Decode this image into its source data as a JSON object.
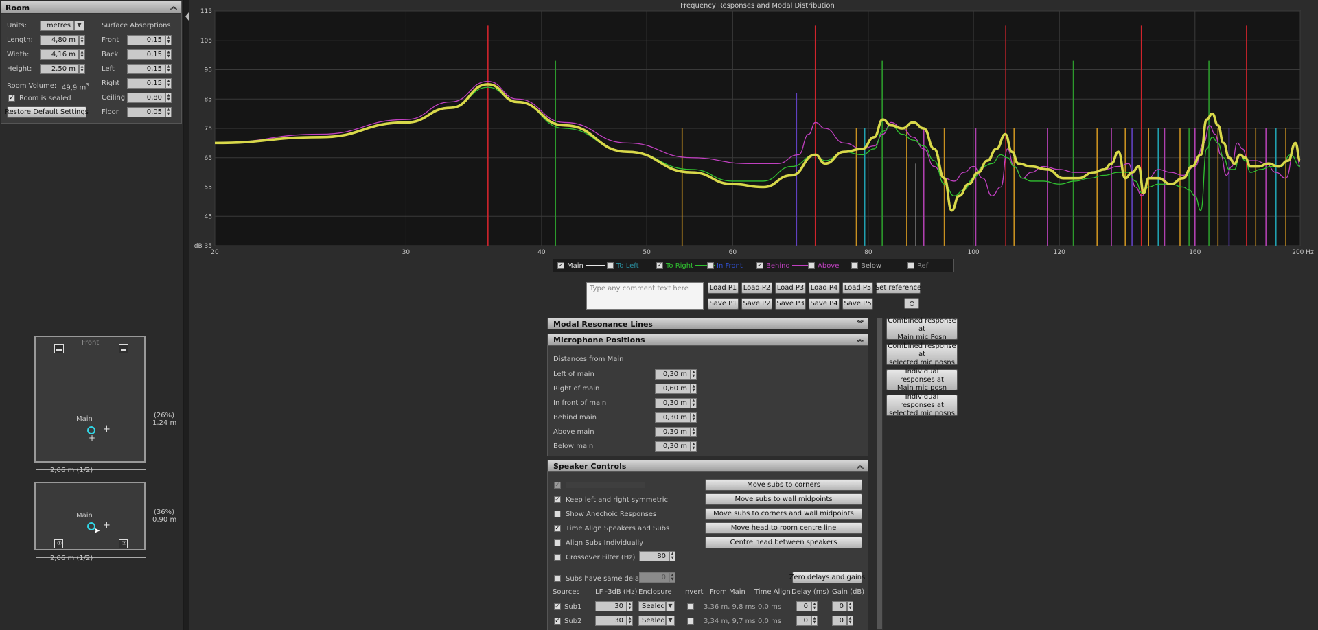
{
  "room": {
    "title": "Room",
    "units_label": "Units:",
    "units_value": "metres",
    "length_label": "Length:",
    "length_value": "4,80 m",
    "width_label": "Width:",
    "width_value": "4,16 m",
    "height_label": "Height:",
    "height_value": "2,50 m",
    "volume_label": "Room Volume:",
    "volume_value": "49,9 m",
    "volume_exp": "3",
    "sealed_label": "Room is sealed",
    "restore_label": "Restore Default Settings",
    "absorptions_title": "Surface Absorptions",
    "absorptions": [
      {
        "label": "Front",
        "value": "0,15"
      },
      {
        "label": "Back",
        "value": "0,15"
      },
      {
        "label": "Left",
        "value": "0,15"
      },
      {
        "label": "Right",
        "value": "0,15"
      },
      {
        "label": "Ceiling",
        "value": "0,80"
      },
      {
        "label": "Floor",
        "value": "0,05"
      }
    ]
  },
  "plan_top": {
    "front_label": "Front",
    "main_label": "Main",
    "pct": "(26%)",
    "dim_right": "1,24 m",
    "dim_bottom": "2,06 m (1/2)"
  },
  "plan_side": {
    "main_label": "Main",
    "pct": "(36%)",
    "dim_right": "0,90 m",
    "dim_bottom": "2,06 m (1/2)"
  },
  "chart_data": {
    "type": "line",
    "title": "Frequency Responses and Modal Distribution",
    "ylabel": "dB",
    "xlabel": "Hz",
    "xscale": "log",
    "xlim": [
      20,
      200
    ],
    "ylim": [
      35,
      115
    ],
    "xticks": [
      20,
      30,
      40,
      50,
      60,
      80,
      100,
      120,
      160,
      200
    ],
    "xtick_labels": [
      "20",
      "30",
      "40",
      "50",
      "60",
      "80",
      "100",
      "120",
      "160",
      "200 Hz"
    ],
    "yticks": [
      35,
      45,
      55,
      65,
      75,
      85,
      95,
      105,
      115
    ],
    "ytick_labels": [
      "dB 35",
      "45",
      "55",
      "65",
      "75",
      "85",
      "95",
      "105",
      "115"
    ],
    "grid": true,
    "background": "#151515",
    "modal_lines": [
      {
        "f": 35.7,
        "h": 110,
        "color": "#d0242c"
      },
      {
        "f": 41.2,
        "h": 98,
        "color": "#2c9a2c"
      },
      {
        "f": 53.9,
        "h": 75,
        "color": "#c89020"
      },
      {
        "f": 68.7,
        "h": 87,
        "color": "#6040c0"
      },
      {
        "f": 71.5,
        "h": 110,
        "color": "#d0242c"
      },
      {
        "f": 78.0,
        "h": 75,
        "color": "#c89020"
      },
      {
        "f": 79.4,
        "h": 75,
        "color": "#20a0b0"
      },
      {
        "f": 82.4,
        "h": 98,
        "color": "#2c9a2c"
      },
      {
        "f": 86.8,
        "h": 75,
        "color": "#c89020"
      },
      {
        "f": 88.5,
        "h": 63,
        "color": "#909090"
      },
      {
        "f": 90.0,
        "h": 75,
        "color": "#b040b0"
      },
      {
        "f": 94.0,
        "h": 75,
        "color": "#c89020"
      },
      {
        "f": 100.5,
        "h": 75,
        "color": "#b040b0"
      },
      {
        "f": 107.1,
        "h": 110,
        "color": "#d0242c"
      },
      {
        "f": 109.0,
        "h": 75,
        "color": "#c89020"
      },
      {
        "f": 117.0,
        "h": 75,
        "color": "#b040b0"
      },
      {
        "f": 123.6,
        "h": 98,
        "color": "#2c9a2c"
      },
      {
        "f": 130.0,
        "h": 75,
        "color": "#c89020"
      },
      {
        "f": 134.0,
        "h": 75,
        "color": "#b040b0"
      },
      {
        "f": 138.0,
        "h": 75,
        "color": "#c89020"
      },
      {
        "f": 140.0,
        "h": 75,
        "color": "#6040c0"
      },
      {
        "f": 142.8,
        "h": 110,
        "color": "#d0242c"
      },
      {
        "f": 145.0,
        "h": 75,
        "color": "#c89020"
      },
      {
        "f": 148.0,
        "h": 75,
        "color": "#20a0b0"
      },
      {
        "f": 150.0,
        "h": 75,
        "color": "#b040b0"
      },
      {
        "f": 155.0,
        "h": 75,
        "color": "#c89020"
      },
      {
        "f": 158.0,
        "h": 75,
        "color": "#2c9a2c"
      },
      {
        "f": 160.0,
        "h": 75,
        "color": "#b040b0"
      },
      {
        "f": 164.8,
        "h": 98,
        "color": "#2c9a2c"
      },
      {
        "f": 168.0,
        "h": 75,
        "color": "#c89020"
      },
      {
        "f": 172.0,
        "h": 75,
        "color": "#6040c0"
      },
      {
        "f": 178.5,
        "h": 110,
        "color": "#d0242c"
      },
      {
        "f": 182.0,
        "h": 75,
        "color": "#c89020"
      },
      {
        "f": 186.0,
        "h": 75,
        "color": "#b040b0"
      },
      {
        "f": 190.0,
        "h": 75,
        "color": "#20a0b0"
      },
      {
        "f": 194.0,
        "h": 75,
        "color": "#c89020"
      }
    ],
    "series": [
      {
        "name": "Behind",
        "color": "#c040c0",
        "width": 1.3,
        "x": [
          20,
          25,
          30,
          33,
          35.7,
          38,
          42,
          48,
          55,
          62,
          66,
          69,
          70.5,
          71.5,
          73,
          76,
          79,
          81,
          82.5,
          84,
          86,
          88,
          90,
          92,
          94,
          96,
          98,
          100,
          102,
          104,
          106,
          107.5,
          109,
          111,
          113,
          116,
          120,
          124,
          128,
          132,
          136,
          139,
          141,
          143,
          145,
          148,
          152,
          156,
          160,
          163,
          165,
          167,
          169,
          171,
          173,
          175,
          177,
          179,
          182,
          186,
          190,
          194,
          198,
          200
        ],
        "y": [
          70,
          73,
          78,
          84,
          91,
          85,
          77,
          70,
          65,
          63,
          63,
          66,
          73,
          77,
          75,
          70,
          68,
          69,
          73,
          77,
          75,
          72,
          68,
          62,
          58,
          57,
          60,
          62,
          58,
          52,
          55,
          68,
          62,
          58,
          60,
          62,
          61,
          60,
          60,
          61,
          62,
          63,
          55,
          52,
          58,
          61,
          60,
          59,
          62,
          70,
          76,
          73,
          66,
          59,
          62,
          70,
          68,
          64,
          64,
          63,
          60,
          58,
          70,
          62
        ]
      },
      {
        "name": "To Right",
        "color": "#30c030",
        "width": 1.3,
        "x": [
          20,
          25,
          30,
          33,
          35.7,
          38,
          42,
          48,
          55,
          60,
          64,
          68,
          71.5,
          73,
          76,
          79,
          81,
          82.5,
          84,
          86,
          88,
          90,
          92,
          94,
          96,
          98,
          100,
          102,
          104,
          106,
          107.5,
          109,
          111,
          113,
          116,
          120,
          124,
          128,
          132,
          136,
          139,
          141,
          143,
          145,
          148,
          152,
          156,
          158,
          160,
          162,
          164,
          166,
          168,
          170,
          172,
          174,
          176,
          178,
          180,
          184,
          188,
          192,
          196,
          200
        ],
        "y": [
          70,
          72,
          77,
          82,
          89,
          84,
          75,
          67,
          61,
          57,
          57,
          62,
          66,
          64,
          67,
          66,
          68,
          74,
          76,
          73,
          71,
          69,
          64,
          56,
          52,
          54,
          58,
          62,
          63,
          66,
          65,
          62,
          58,
          57,
          57,
          56,
          57,
          58,
          59,
          60,
          60,
          57,
          53,
          55,
          56,
          56,
          55,
          54,
          52,
          47,
          68,
          72,
          70,
          65,
          61,
          61,
          66,
          64,
          60,
          61,
          62,
          62,
          66,
          62
        ]
      },
      {
        "name": "Main",
        "color": "#d8d84a",
        "width": 3.6,
        "x": [
          20,
          25,
          30,
          33,
          35.7,
          38,
          42,
          48,
          55,
          60,
          64,
          68,
          71.5,
          73,
          76,
          79,
          81,
          82.5,
          84,
          86,
          88,
          90,
          92,
          94,
          95.5,
          97,
          99,
          101,
          103,
          105,
          107,
          108.5,
          110,
          113,
          117,
          121,
          125,
          129,
          132,
          134,
          136,
          138,
          140,
          142,
          143.5,
          145,
          148,
          152,
          156,
          159,
          162,
          164,
          166,
          168,
          170,
          172,
          174,
          176,
          178,
          180,
          183,
          187,
          191,
          195,
          198,
          200
        ],
        "y": [
          70,
          72,
          77,
          82,
          90,
          84,
          76,
          67,
          60,
          56,
          55,
          59,
          66,
          63,
          67,
          68,
          72,
          78,
          76,
          75,
          77,
          75,
          68,
          58,
          47,
          52,
          56,
          60,
          64,
          68,
          73,
          67,
          63,
          62,
          61,
          58,
          58,
          60,
          61,
          63,
          67,
          58,
          60,
          62,
          53,
          58,
          58,
          56,
          58,
          62,
          66,
          78,
          80,
          76,
          70,
          65,
          63,
          66,
          65,
          62,
          62,
          63,
          62,
          64,
          70,
          64
        ]
      }
    ],
    "legend": [
      {
        "label": "Main",
        "checked": true,
        "color": "#e0e0e0",
        "swatch": "#e8e8e8"
      },
      {
        "label": "To Left",
        "checked": false,
        "color": "#2a8fa0",
        "swatch": ""
      },
      {
        "label": "To Right",
        "checked": true,
        "color": "#30c030",
        "swatch": "#30c030"
      },
      {
        "label": "In Front",
        "checked": false,
        "color": "#3050d0",
        "swatch": ""
      },
      {
        "label": "Behind",
        "checked": true,
        "color": "#c040c0",
        "swatch": "#c040c0"
      },
      {
        "label": "Above",
        "checked": false,
        "color": "#c040c0",
        "swatch": ""
      },
      {
        "label": "Below",
        "checked": false,
        "color": "#aaaaaa",
        "swatch": ""
      },
      {
        "label": "Ref",
        "checked": false,
        "color": "#888888",
        "swatch": ""
      }
    ]
  },
  "comment": {
    "placeholder": "Type any comment text here"
  },
  "presets": {
    "load": [
      "Load P1",
      "Load P2",
      "Load P3",
      "Load P4",
      "Load P5"
    ],
    "save": [
      "Save P1",
      "Save P2",
      "Save P3",
      "Save P4",
      "Save P5"
    ],
    "set_reference": "Set reference"
  },
  "sections": {
    "modal": "Modal Resonance Lines",
    "mic": "Microphone Positions",
    "speaker": "Speaker Controls"
  },
  "mic": {
    "distances_title": "Distances from Main",
    "rows": [
      {
        "label": "Left of main",
        "value": "0,30 m"
      },
      {
        "label": "Right of main",
        "value": "0,60 m"
      },
      {
        "label": "In front of main",
        "value": "0,30 m"
      },
      {
        "label": "Behind main",
        "value": "0,30 m"
      },
      {
        "label": "Above main",
        "value": "0,30 m"
      },
      {
        "label": "Below main",
        "value": "0,30 m"
      }
    ]
  },
  "response_buttons": [
    "Combined response at\nMain mic Posn",
    "Combined response at\nselected mic posns",
    "Individual responses at\nMain mic posn",
    "Individual responses at\nselected mic posns"
  ],
  "speaker": {
    "checks": [
      {
        "label": "Keep left and right symmetric",
        "checked": true
      },
      {
        "label": "Show Anechoic Responses",
        "checked": false
      },
      {
        "label": "Time Align Speakers and Subs",
        "checked": true
      },
      {
        "label": "Align Subs Individually",
        "checked": false
      },
      {
        "label": "Crossover Filter (Hz)",
        "checked": false
      }
    ],
    "crossover_value": "80",
    "same_delay_label": "Subs have same delay",
    "same_delay_value": "0",
    "buttons": [
      "Move subs to corners",
      "Move subs to wall midpoints",
      "Move subs to corners and wall midpoints",
      "Move head to room centre line",
      "Centre head between speakers"
    ],
    "zero_button": "Zero delays and gains",
    "headers": [
      "Sources",
      "LF -3dB (Hz)",
      "Enclosure",
      "Invert",
      "From Main",
      "Time Align",
      "Delay (ms)",
      "Gain (dB)"
    ],
    "subs": [
      {
        "name": "Sub1",
        "checked": true,
        "lf": "30",
        "enclosure": "Sealed",
        "from_main": "3,36 m, 9,8 ms",
        "time_align": "0,0 ms",
        "delay": "0",
        "gain": "0"
      },
      {
        "name": "Sub2",
        "checked": true,
        "lf": "30",
        "enclosure": "Sealed",
        "from_main": "3,34 m, 9,7 ms",
        "time_align": "0,0 ms",
        "delay": "0",
        "gain": "0"
      }
    ]
  }
}
